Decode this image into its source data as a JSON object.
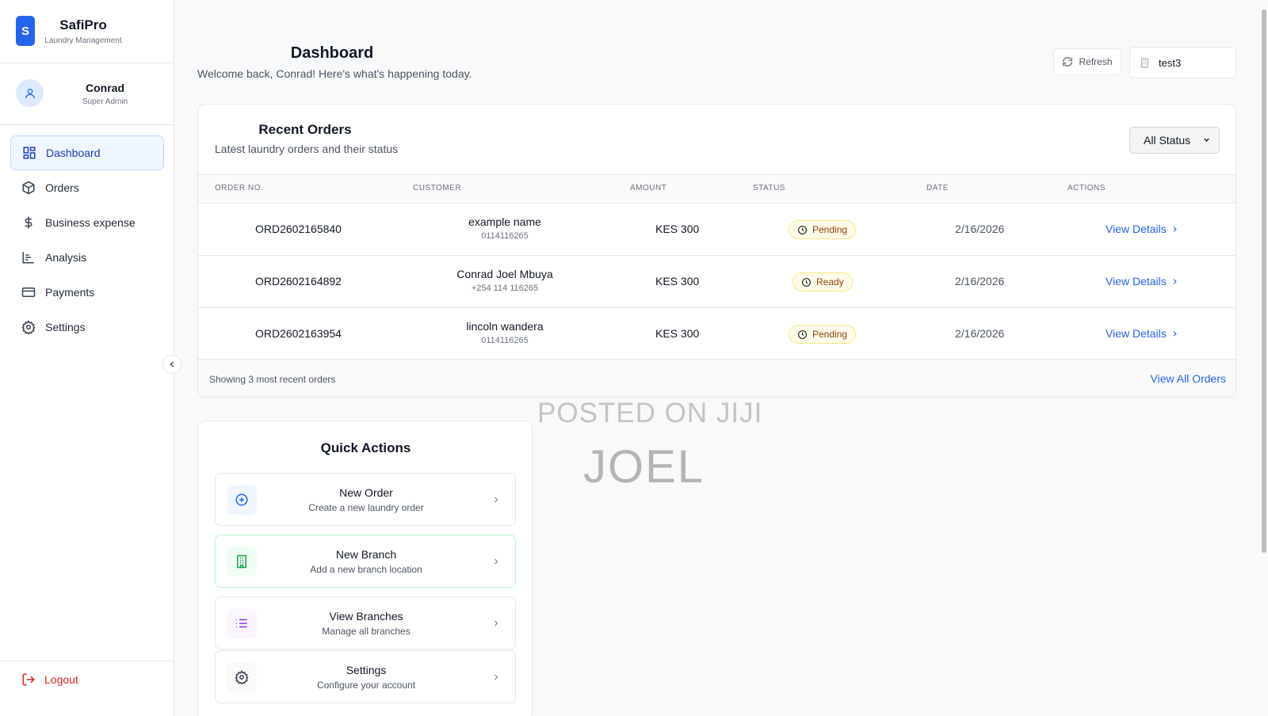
{
  "brand": {
    "logo_letter": "S",
    "name": "SafiPro",
    "subtitle": "Laundry Management",
    "accent": "#2563eb"
  },
  "user": {
    "name": "Conrad",
    "role": "Super Admin",
    "avatar_icon": "user-icon"
  },
  "sidebar": {
    "items": [
      {
        "label": "Dashboard",
        "icon": "grid-icon",
        "active": true
      },
      {
        "label": "Orders",
        "icon": "package-icon"
      },
      {
        "label": "Business expense",
        "icon": "dollar-icon"
      },
      {
        "label": "Analysis",
        "icon": "bar-chart-icon"
      },
      {
        "label": "Payments",
        "icon": "credit-card-icon"
      },
      {
        "label": "Settings",
        "icon": "gear-icon"
      }
    ],
    "logout_label": "Logout",
    "logout_color": "#dc2626"
  },
  "header": {
    "title": "Dashboard",
    "subtitle": "Welcome back, Conrad! Here's what's happening today.",
    "refresh_label": "Refresh",
    "branch_value": "test3"
  },
  "orders": {
    "title": "Recent Orders",
    "subtitle": "Latest laundry orders and their status",
    "filter_value": "All Status",
    "columns": [
      "ORDER NO.",
      "CUSTOMER",
      "AMOUNT",
      "STATUS",
      "DATE",
      "ACTIONS"
    ],
    "rows": [
      {
        "order_no": "ORD2602165840",
        "customer": "example name",
        "phone": "0114116265",
        "amount": "KES 300",
        "status": "Pending",
        "date": "2/16/2026",
        "action": "View Details"
      },
      {
        "order_no": "ORD2602164892",
        "customer": "Conrad Joel Mbuya",
        "phone": "+254 114 116265",
        "amount": "KES 300",
        "status": "Ready",
        "date": "2/16/2026",
        "action": "View Details"
      },
      {
        "order_no": "ORD2602163954",
        "customer": "lincoln wandera",
        "phone": "0114116265",
        "amount": "KES 300",
        "status": "Pending",
        "date": "2/16/2026",
        "action": "View Details"
      }
    ],
    "footer_text": "Showing 3 most recent orders",
    "view_all_label": "View All Orders"
  },
  "quick_actions": {
    "title": "Quick Actions",
    "items": [
      {
        "label": "New Order",
        "desc": "Create a new laundry order",
        "icon": "plus-circle-icon",
        "color": "#2563eb"
      },
      {
        "label": "New Branch",
        "desc": "Add a new branch location",
        "icon": "building-icon",
        "color": "#16a34a"
      },
      {
        "label": "View Branches",
        "desc": "Manage all branches",
        "icon": "list-icon",
        "color": "#9333ea"
      },
      {
        "label": "Settings",
        "desc": "Configure your account",
        "icon": "gear-icon",
        "color": "#374151"
      }
    ]
  },
  "watermark": {
    "line1": "POSTED ON JIJI",
    "line2": "JOEL"
  }
}
